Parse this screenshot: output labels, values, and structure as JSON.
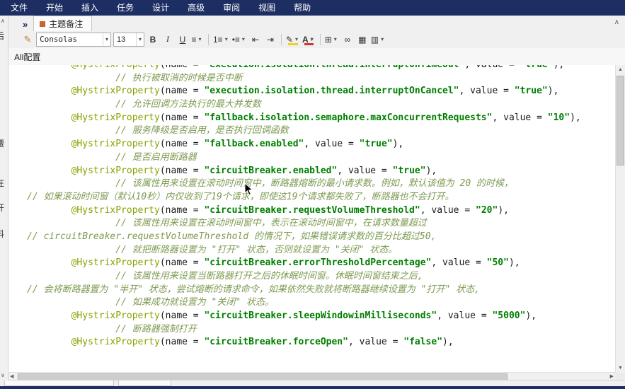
{
  "menubar": {
    "items": [
      "文件",
      "开始",
      "插入",
      "任务",
      "设计",
      "高级",
      "审阅",
      "视图",
      "帮助"
    ]
  },
  "ribbon": {
    "expand_chevron": "»",
    "doc_tab_label": "主题备注",
    "collapse_arrow": "∧",
    "toolbar": {
      "format_painter_icon": "✎",
      "font_name": "Consolas",
      "font_size": "13",
      "bold_label": "B",
      "italic_label": "I",
      "underline_label": "U",
      "align_icon": "≡",
      "numbered_list_icon": "1≡",
      "bullet_list_icon": "•≡",
      "outdent_icon": "⇤",
      "indent_icon": "⇥",
      "highlight_icon": "✎",
      "font_color_icon": "A",
      "highlight_color": "#f3d11a",
      "font_color": "#d03a2b",
      "table_icon": "⊞",
      "link_icon": "∞",
      "image_icon": "▦",
      "attach_icon": "▥",
      "dropdown_arrow": "▾"
    }
  },
  "left_panel": {
    "up_arrow": "∧",
    "down_arrow": "∨",
    "clipped_text": [
      "后",
      "腰",
      "在",
      "开",
      "抖"
    ]
  },
  "document": {
    "header_tab": "All配置"
  },
  "scrollbars": {
    "up_arrow": "▲",
    "down_arrow": "▼",
    "left_arrow": "◀",
    "right_arrow": "▶"
  },
  "colors": {
    "menubar_bg": "#1d2e63",
    "annotation": "#86a300",
    "string": "#007f00",
    "comment": "#7e9b52"
  },
  "editor": {
    "lines": [
      {
        "indent": 8,
        "segments": [
          {
            "type": "ann",
            "text": "@HystrixProperty"
          },
          {
            "type": "pln",
            "text": "(name = "
          },
          {
            "type": "str",
            "text": "\"execution.isolation.thread.interruptOnTimeout\""
          },
          {
            "type": "pln",
            "text": ", value = "
          },
          {
            "type": "str",
            "text": "\"true\""
          },
          {
            "type": "pln",
            "text": "),"
          }
        ]
      },
      {
        "indent": 16,
        "segments": [
          {
            "type": "com",
            "text": "// 执行被取消的时候是否中断"
          }
        ]
      },
      {
        "indent": 8,
        "segments": [
          {
            "type": "ann",
            "text": "@HystrixProperty"
          },
          {
            "type": "pln",
            "text": "(name = "
          },
          {
            "type": "str",
            "text": "\"execution.isolation.thread.interruptOnCancel\""
          },
          {
            "type": "pln",
            "text": ", value = "
          },
          {
            "type": "str",
            "text": "\"true\""
          },
          {
            "type": "pln",
            "text": "),"
          }
        ]
      },
      {
        "indent": 16,
        "segments": [
          {
            "type": "com",
            "text": "// 允许回调方法执行的最大并发数"
          }
        ]
      },
      {
        "indent": 8,
        "segments": [
          {
            "type": "ann",
            "text": "@HystrixProperty"
          },
          {
            "type": "pln",
            "text": "(name = "
          },
          {
            "type": "str",
            "text": "\"fallback.isolation.semaphore.maxConcurrentRequests\""
          },
          {
            "type": "pln",
            "text": ", value = "
          },
          {
            "type": "str",
            "text": "\"10\""
          },
          {
            "type": "pln",
            "text": "),"
          }
        ]
      },
      {
        "indent": 16,
        "segments": [
          {
            "type": "com",
            "text": "// 服务降级是否启用，是否执行回调函数"
          }
        ]
      },
      {
        "indent": 8,
        "segments": [
          {
            "type": "ann",
            "text": "@HystrixProperty"
          },
          {
            "type": "pln",
            "text": "(name = "
          },
          {
            "type": "str",
            "text": "\"fallback.enabled\""
          },
          {
            "type": "pln",
            "text": ", value = "
          },
          {
            "type": "str",
            "text": "\"true\""
          },
          {
            "type": "pln",
            "text": "),"
          }
        ]
      },
      {
        "indent": 16,
        "segments": [
          {
            "type": "com",
            "text": "// 是否启用断路器"
          }
        ]
      },
      {
        "indent": 8,
        "segments": [
          {
            "type": "ann",
            "text": "@HystrixProperty"
          },
          {
            "type": "pln",
            "text": "(name = "
          },
          {
            "type": "str",
            "text": "\"circuitBreaker.enabled\""
          },
          {
            "type": "pln",
            "text": ", value = "
          },
          {
            "type": "str",
            "text": "\"true\""
          },
          {
            "type": "pln",
            "text": "),"
          }
        ]
      },
      {
        "indent": 16,
        "segments": [
          {
            "type": "com",
            "text": "// 该属性用来设置在滚动时间窗中，断路器熔断的最小请求数。例如，默认该值为 20 的时候，"
          }
        ]
      },
      {
        "indent": 0,
        "segments": [
          {
            "type": "com",
            "text": "// 如果滚动时间窗（默认10秒）内仅收到了19个请求，即使这19个请求都失败了，断路器也不会打开。"
          }
        ]
      },
      {
        "indent": 8,
        "segments": [
          {
            "type": "ann",
            "text": "@HystrixProperty"
          },
          {
            "type": "pln",
            "text": "(name = "
          },
          {
            "type": "str",
            "text": "\"circuitBreaker.requestVolumeThreshold\""
          },
          {
            "type": "pln",
            "text": ", value = "
          },
          {
            "type": "str",
            "text": "\"20\""
          },
          {
            "type": "pln",
            "text": "),"
          }
        ]
      },
      {
        "indent": 16,
        "segments": [
          {
            "type": "com",
            "text": "// 该属性用来设置在滚动时间窗中，表示在滚动时间窗中，在请求数量超过"
          }
        ]
      },
      {
        "indent": 0,
        "segments": [
          {
            "type": "com",
            "text": "// circuitBreaker.requestVolumeThreshold 的情况下，如果错误请求数的百分比超过50,"
          }
        ]
      },
      {
        "indent": 16,
        "segments": [
          {
            "type": "com",
            "text": "// 就把断路器设置为 \"打开\" 状态，否则就设置为 \"关闭\" 状态。"
          }
        ]
      },
      {
        "indent": 8,
        "segments": [
          {
            "type": "ann",
            "text": "@HystrixProperty"
          },
          {
            "type": "pln",
            "text": "(name = "
          },
          {
            "type": "str",
            "text": "\"circuitBreaker.errorThresholdPercentage\""
          },
          {
            "type": "pln",
            "text": ", value = "
          },
          {
            "type": "str",
            "text": "\"50\""
          },
          {
            "type": "pln",
            "text": "),"
          }
        ]
      },
      {
        "indent": 16,
        "segments": [
          {
            "type": "com",
            "text": "// 该属性用来设置当断路器打开之后的休眠时间窗。休眠时间窗结束之后,"
          }
        ]
      },
      {
        "indent": 0,
        "segments": [
          {
            "type": "com",
            "text": "// 会将断路器置为 \"半开\" 状态，尝试熔断的请求命令，如果依然失败就将断路器继续设置为 \"打开\" 状态,"
          }
        ]
      },
      {
        "indent": 16,
        "segments": [
          {
            "type": "com",
            "text": "// 如果成功就设置为 \"关闭\" 状态。"
          }
        ]
      },
      {
        "indent": 8,
        "segments": [
          {
            "type": "ann",
            "text": "@HystrixProperty"
          },
          {
            "type": "pln",
            "text": "(name = "
          },
          {
            "type": "str",
            "text": "\"circuitBreaker.sleepWindowinMilliseconds\""
          },
          {
            "type": "pln",
            "text": ", value = "
          },
          {
            "type": "str",
            "text": "\"5000\""
          },
          {
            "type": "pln",
            "text": "),"
          }
        ]
      },
      {
        "indent": 16,
        "segments": [
          {
            "type": "com",
            "text": "// 断路器强制打开"
          }
        ]
      },
      {
        "indent": 8,
        "segments": [
          {
            "type": "ann",
            "text": "@HystrixProperty"
          },
          {
            "type": "pln",
            "text": "(name = "
          },
          {
            "type": "str",
            "text": "\"circuitBreaker.forceOpen\""
          },
          {
            "type": "pln",
            "text": ", value = "
          },
          {
            "type": "str",
            "text": "\"false\""
          },
          {
            "type": "pln",
            "text": "),"
          }
        ]
      }
    ]
  }
}
